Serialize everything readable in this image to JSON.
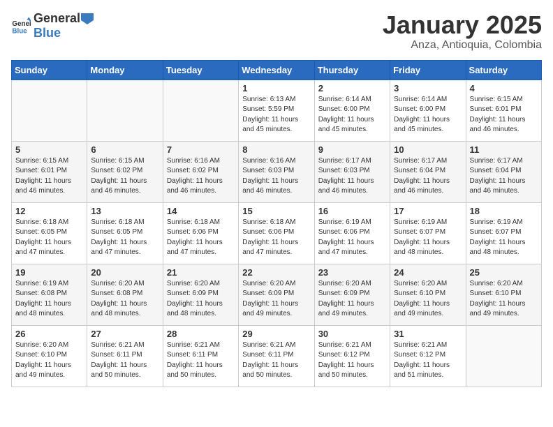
{
  "header": {
    "logo_general": "General",
    "logo_blue": "Blue",
    "title": "January 2025",
    "subtitle": "Anza, Antioquia, Colombia"
  },
  "weekdays": [
    "Sunday",
    "Monday",
    "Tuesday",
    "Wednesday",
    "Thursday",
    "Friday",
    "Saturday"
  ],
  "weeks": [
    [
      {
        "day": "",
        "info": ""
      },
      {
        "day": "",
        "info": ""
      },
      {
        "day": "",
        "info": ""
      },
      {
        "day": "1",
        "info": "Sunrise: 6:13 AM\nSunset: 5:59 PM\nDaylight: 11 hours\nand 45 minutes."
      },
      {
        "day": "2",
        "info": "Sunrise: 6:14 AM\nSunset: 6:00 PM\nDaylight: 11 hours\nand 45 minutes."
      },
      {
        "day": "3",
        "info": "Sunrise: 6:14 AM\nSunset: 6:00 PM\nDaylight: 11 hours\nand 45 minutes."
      },
      {
        "day": "4",
        "info": "Sunrise: 6:15 AM\nSunset: 6:01 PM\nDaylight: 11 hours\nand 46 minutes."
      }
    ],
    [
      {
        "day": "5",
        "info": "Sunrise: 6:15 AM\nSunset: 6:01 PM\nDaylight: 11 hours\nand 46 minutes."
      },
      {
        "day": "6",
        "info": "Sunrise: 6:15 AM\nSunset: 6:02 PM\nDaylight: 11 hours\nand 46 minutes."
      },
      {
        "day": "7",
        "info": "Sunrise: 6:16 AM\nSunset: 6:02 PM\nDaylight: 11 hours\nand 46 minutes."
      },
      {
        "day": "8",
        "info": "Sunrise: 6:16 AM\nSunset: 6:03 PM\nDaylight: 11 hours\nand 46 minutes."
      },
      {
        "day": "9",
        "info": "Sunrise: 6:17 AM\nSunset: 6:03 PM\nDaylight: 11 hours\nand 46 minutes."
      },
      {
        "day": "10",
        "info": "Sunrise: 6:17 AM\nSunset: 6:04 PM\nDaylight: 11 hours\nand 46 minutes."
      },
      {
        "day": "11",
        "info": "Sunrise: 6:17 AM\nSunset: 6:04 PM\nDaylight: 11 hours\nand 46 minutes."
      }
    ],
    [
      {
        "day": "12",
        "info": "Sunrise: 6:18 AM\nSunset: 6:05 PM\nDaylight: 11 hours\nand 47 minutes."
      },
      {
        "day": "13",
        "info": "Sunrise: 6:18 AM\nSunset: 6:05 PM\nDaylight: 11 hours\nand 47 minutes."
      },
      {
        "day": "14",
        "info": "Sunrise: 6:18 AM\nSunset: 6:06 PM\nDaylight: 11 hours\nand 47 minutes."
      },
      {
        "day": "15",
        "info": "Sunrise: 6:18 AM\nSunset: 6:06 PM\nDaylight: 11 hours\nand 47 minutes."
      },
      {
        "day": "16",
        "info": "Sunrise: 6:19 AM\nSunset: 6:06 PM\nDaylight: 11 hours\nand 47 minutes."
      },
      {
        "day": "17",
        "info": "Sunrise: 6:19 AM\nSunset: 6:07 PM\nDaylight: 11 hours\nand 48 minutes."
      },
      {
        "day": "18",
        "info": "Sunrise: 6:19 AM\nSunset: 6:07 PM\nDaylight: 11 hours\nand 48 minutes."
      }
    ],
    [
      {
        "day": "19",
        "info": "Sunrise: 6:19 AM\nSunset: 6:08 PM\nDaylight: 11 hours\nand 48 minutes."
      },
      {
        "day": "20",
        "info": "Sunrise: 6:20 AM\nSunset: 6:08 PM\nDaylight: 11 hours\nand 48 minutes."
      },
      {
        "day": "21",
        "info": "Sunrise: 6:20 AM\nSunset: 6:09 PM\nDaylight: 11 hours\nand 48 minutes."
      },
      {
        "day": "22",
        "info": "Sunrise: 6:20 AM\nSunset: 6:09 PM\nDaylight: 11 hours\nand 49 minutes."
      },
      {
        "day": "23",
        "info": "Sunrise: 6:20 AM\nSunset: 6:09 PM\nDaylight: 11 hours\nand 49 minutes."
      },
      {
        "day": "24",
        "info": "Sunrise: 6:20 AM\nSunset: 6:10 PM\nDaylight: 11 hours\nand 49 minutes."
      },
      {
        "day": "25",
        "info": "Sunrise: 6:20 AM\nSunset: 6:10 PM\nDaylight: 11 hours\nand 49 minutes."
      }
    ],
    [
      {
        "day": "26",
        "info": "Sunrise: 6:20 AM\nSunset: 6:10 PM\nDaylight: 11 hours\nand 49 minutes."
      },
      {
        "day": "27",
        "info": "Sunrise: 6:21 AM\nSunset: 6:11 PM\nDaylight: 11 hours\nand 50 minutes."
      },
      {
        "day": "28",
        "info": "Sunrise: 6:21 AM\nSunset: 6:11 PM\nDaylight: 11 hours\nand 50 minutes."
      },
      {
        "day": "29",
        "info": "Sunrise: 6:21 AM\nSunset: 6:11 PM\nDaylight: 11 hours\nand 50 minutes."
      },
      {
        "day": "30",
        "info": "Sunrise: 6:21 AM\nSunset: 6:12 PM\nDaylight: 11 hours\nand 50 minutes."
      },
      {
        "day": "31",
        "info": "Sunrise: 6:21 AM\nSunset: 6:12 PM\nDaylight: 11 hours\nand 51 minutes."
      },
      {
        "day": "",
        "info": ""
      }
    ]
  ]
}
